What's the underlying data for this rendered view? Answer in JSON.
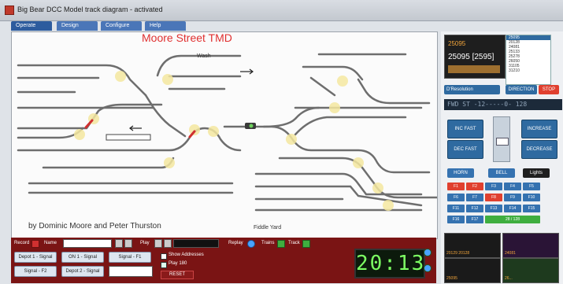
{
  "window": {
    "title": "Big Bear DCC Model track diagram - activated"
  },
  "tabs": [
    {
      "label": "Operate"
    },
    {
      "label": "Design"
    },
    {
      "label": "Configure"
    },
    {
      "label": "Help"
    }
  ],
  "layout": {
    "title": "Moore Street TMD",
    "credits": "by Dominic Moore and Peter Thurston",
    "labels": {
      "wash": "Wash",
      "fiddle_yard": "Fiddle Yard"
    }
  },
  "bottom_bar": {
    "record_label": "Record",
    "name_label": "Name",
    "play_label": "Play",
    "replay_label": "Replay",
    "trains_label": "Trains",
    "track_label": "Track",
    "show_addresses_label": "Show Addresses",
    "play_label_2": "Play 180",
    "reset_label": "RESET",
    "signal_buttons": [
      "Depot 1 - Signal",
      "ON 1 - Signal",
      "Signal - F1",
      "Signal - F2",
      "Depot 2 - Signal"
    ],
    "clock": "20:13"
  },
  "loco": {
    "number_top": "25095",
    "number_main": "25095 [2595]",
    "list": [
      "25095",
      "20128",
      "24081",
      "25133",
      "25278",
      "26050",
      "31105",
      "31210"
    ],
    "selected_list_item": "25095",
    "select_value": "D'Resolution",
    "direction_label": "DIRECTION",
    "stop_label": "STOP",
    "speed_readout": "FWD  ST  -12-----0- 128",
    "inc_fast": "INC FAST",
    "dec_fast": "DEC FAST",
    "increase": "INCREASE",
    "decrease": "DECREASE",
    "horn_label": "HORN",
    "bell_label": "BELL",
    "lights_label": "Lights",
    "function_keys": [
      "F1",
      "F2",
      "F3",
      "F4",
      "F5",
      "F6",
      "F7",
      "F8",
      "F9",
      "F10",
      "F11",
      "F12",
      "F13",
      "F14",
      "F15",
      "F16",
      "F17"
    ],
    "speed_steps_label": "28 / 128"
  },
  "thumbnails": [
    {
      "label": "20129  20128"
    },
    {
      "label": "24081"
    },
    {
      "label": "25095"
    },
    {
      "label": "26..."
    }
  ],
  "colors": {
    "accent": "#2f6aa0",
    "stop": "#e0402f",
    "bottom_bar": "#7a1414",
    "track": "#6e6e6e",
    "point_marker": "#f4e8a0",
    "signal_red": "#d03030"
  }
}
